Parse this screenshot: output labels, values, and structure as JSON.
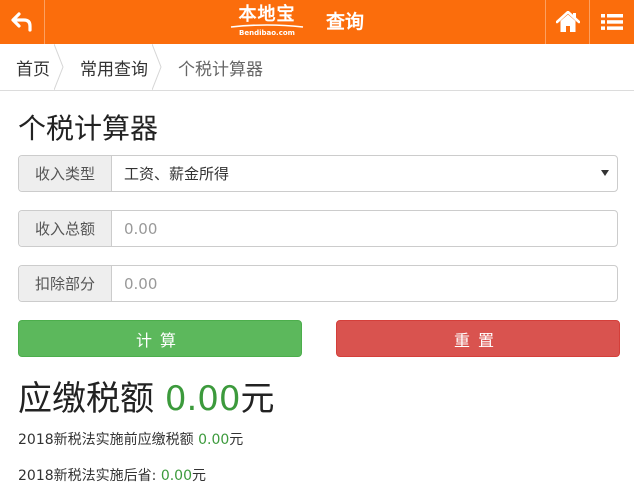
{
  "header": {
    "brand_cn": "本地宝",
    "brand_en": "Bendibao.com",
    "title": "查询",
    "color": "#fb6d0c",
    "icons": [
      "back-arrow-icon",
      "home-icon",
      "menu-list-icon"
    ]
  },
  "breadcrumb": [
    "首页",
    "常用查询",
    "个税计算器"
  ],
  "calculator": {
    "title": "个税计算器",
    "income_type": {
      "label": "收入类型",
      "value": "工资、薪金所得"
    },
    "income_total": {
      "label": "收入总额",
      "placeholder": "0.00"
    },
    "deduction": {
      "label": "扣除部分",
      "placeholder": "0.00"
    },
    "calc_button": "计算",
    "reset_button": "重置"
  },
  "result": {
    "tax_label": "应缴税额",
    "tax_value": "0.00",
    "tax_unit": "元",
    "before_label": "2018新税法实施前应缴税额",
    "before_value": "0.00",
    "before_unit": "元",
    "saved_label": "2018新税法实施后省:",
    "saved_value": "0.00",
    "saved_unit": "元"
  }
}
